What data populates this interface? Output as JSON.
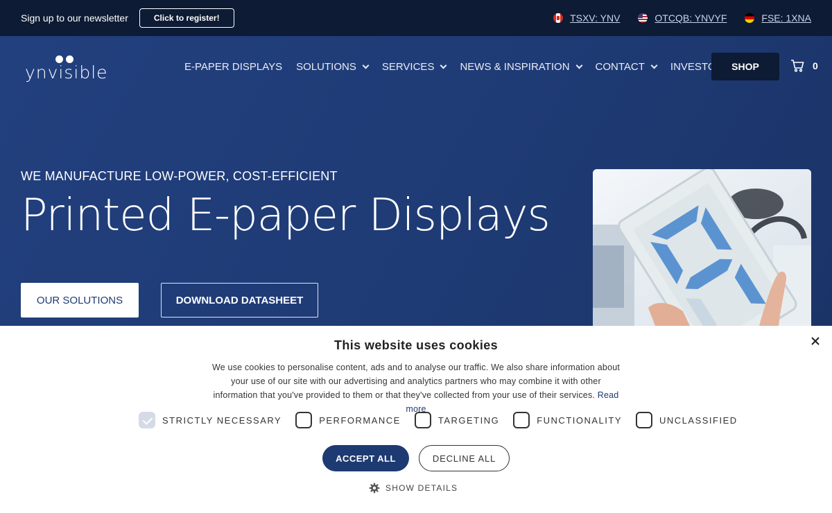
{
  "topbar": {
    "newsletter_text": "Sign up to our newsletter",
    "register_label": "Click to register!",
    "tickers": [
      {
        "label": "TSXV: YNV",
        "flag": "canada-flag-icon"
      },
      {
        "label": "OTCQB: YNVYF",
        "flag": "usa-flag-icon"
      },
      {
        "label": "FSE: 1XNA",
        "flag": "germany-flag-icon"
      }
    ]
  },
  "header": {
    "logo_text": "ynvisible",
    "nav": [
      {
        "label": "E-PAPER DISPLAYS",
        "dropdown": false
      },
      {
        "label": "SOLUTIONS",
        "dropdown": true
      },
      {
        "label": "SERVICES",
        "dropdown": true
      },
      {
        "label": "NEWS & INSPIRATION",
        "dropdown": true
      },
      {
        "label": "CONTACT",
        "dropdown": true
      },
      {
        "label": "INVESTORS",
        "dropdown": false
      }
    ],
    "shop_label": "SHOP",
    "cart_count": "0"
  },
  "hero": {
    "eyebrow": "WE MANUFACTURE LOW-POWER, COST-EFFICIENT",
    "headline": "Printed E-paper Displays",
    "solutions_label": "OUR SOLUTIONS",
    "datasheet_label": "DOWNLOAD DATASHEET"
  },
  "cookie": {
    "title": "This website uses cookies",
    "description": "We use cookies to personalise content, ads and to analyse our traffic. We also share information about your use of our site with our advertising and analytics partners who may combine it with other information that you've provided to them or that they've collected from your use of their services.",
    "read_more": "Read more",
    "categories": [
      {
        "label": "STRICTLY NECESSARY",
        "checked": true
      },
      {
        "label": "PERFORMANCE",
        "checked": false
      },
      {
        "label": "TARGETING",
        "checked": false
      },
      {
        "label": "FUNCTIONALITY",
        "checked": false
      },
      {
        "label": "UNCLASSIFIED",
        "checked": false
      }
    ],
    "accept_label": "ACCEPT ALL",
    "decline_label": "DECLINE ALL",
    "details_label": "SHOW DETAILS"
  },
  "colors": {
    "brand_navy": "#1e3a72",
    "topbar_bg": "#0d1b34",
    "white": "#ffffff"
  }
}
